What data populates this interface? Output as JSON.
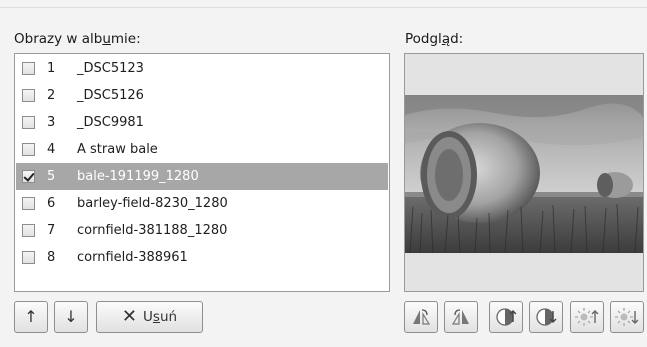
{
  "album": {
    "label_prefix": "Obrazy w alb",
    "label_underlined": "u",
    "label_suffix": "mie:",
    "items": [
      {
        "num": "1",
        "name": "_DSC5123",
        "checked": false,
        "selected": false
      },
      {
        "num": "2",
        "name": "_DSC5126",
        "checked": false,
        "selected": false
      },
      {
        "num": "3",
        "name": "_DSC9981",
        "checked": false,
        "selected": false
      },
      {
        "num": "4",
        "name": "A straw bale",
        "checked": false,
        "selected": false
      },
      {
        "num": "5",
        "name": "bale-191199_1280",
        "checked": true,
        "selected": true
      },
      {
        "num": "6",
        "name": "barley-field-8230_1280",
        "checked": false,
        "selected": false
      },
      {
        "num": "7",
        "name": "cornfield-381188_1280",
        "checked": false,
        "selected": false
      },
      {
        "num": "8",
        "name": "cornfield-388961",
        "checked": false,
        "selected": false
      }
    ]
  },
  "preview": {
    "label_prefix": "Podgl",
    "label_underlined": "ą",
    "label_suffix": "d:"
  },
  "buttons": {
    "move_up_icon": "arrow-up-icon",
    "move_down_icon": "arrow-down-icon",
    "remove_icon": "x-icon",
    "remove_label_prefix": "U",
    "remove_label_underlined": "s",
    "remove_label_suffix": "uń",
    "image_tools": [
      "rotate-left-icon",
      "rotate-right-icon",
      "increase-contrast-icon",
      "decrease-contrast-icon",
      "increase-brightness-icon",
      "decrease-brightness-icon"
    ]
  }
}
